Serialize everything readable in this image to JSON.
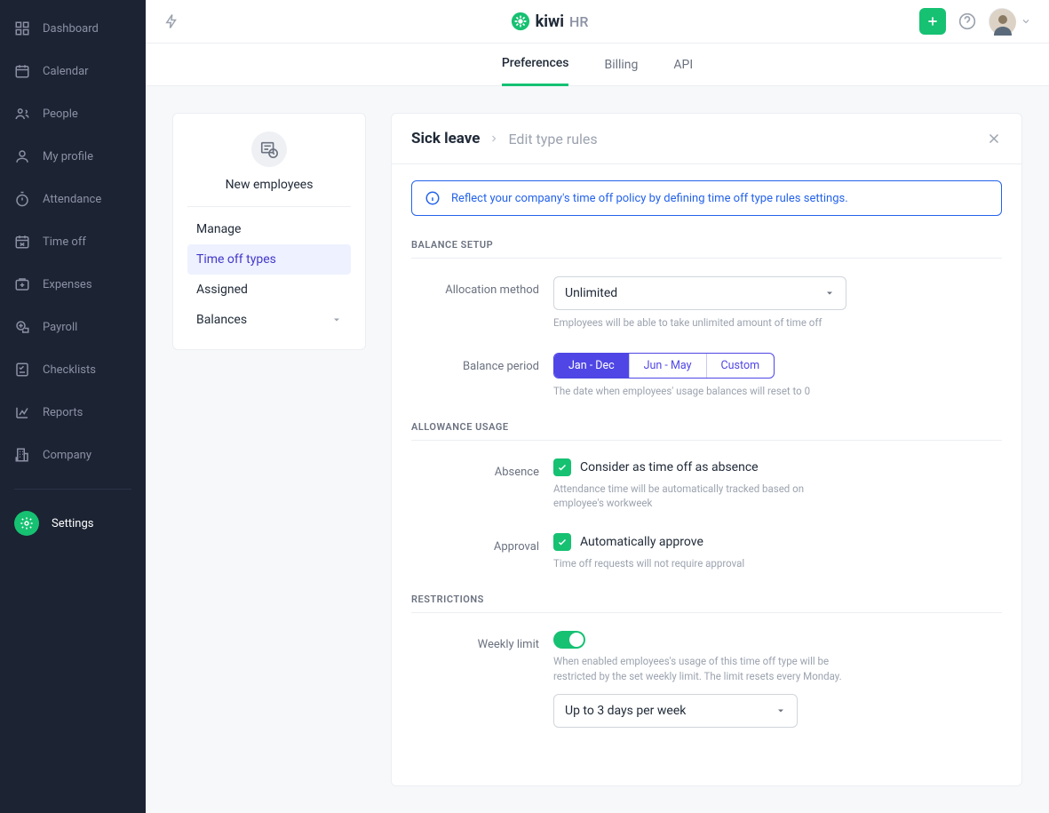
{
  "brand": {
    "name": "kiwi",
    "suffix": "HR"
  },
  "sidebar": {
    "items": [
      {
        "label": "Dashboard"
      },
      {
        "label": "Calendar"
      },
      {
        "label": "People"
      },
      {
        "label": "My profile"
      },
      {
        "label": "Attendance"
      },
      {
        "label": "Time off"
      },
      {
        "label": "Expenses"
      },
      {
        "label": "Payroll"
      },
      {
        "label": "Checklists"
      },
      {
        "label": "Reports"
      },
      {
        "label": "Company"
      }
    ],
    "settings_label": "Settings"
  },
  "tabs": [
    {
      "label": "Preferences",
      "active": true
    },
    {
      "label": "Billing",
      "active": false
    },
    {
      "label": "API",
      "active": false
    }
  ],
  "left_card": {
    "title": "New employees",
    "items": [
      {
        "label": "Manage"
      },
      {
        "label": "Time off types",
        "active": true
      },
      {
        "label": "Assigned"
      },
      {
        "label": "Balances",
        "chevron": true
      }
    ]
  },
  "panel": {
    "breadcrumb": {
      "main": "Sick leave",
      "sub": "Edit type rules"
    },
    "info": "Reflect your company's time off policy by defining time off type rules settings.",
    "sections": {
      "balance_title": "BALANCE SETUP",
      "allowance_title": "ALLOWANCE USAGE",
      "restrictions_title": "RESTRICTIONS"
    },
    "allocation": {
      "label": "Allocation method",
      "value": "Unlimited",
      "help": "Employees will be able to take unlimited amount of time off"
    },
    "balance_period": {
      "label": "Balance period",
      "options": [
        "Jan - Dec",
        "Jun - May",
        "Custom"
      ],
      "help": "The date when employees' usage balances will reset to 0"
    },
    "absence": {
      "label": "Absence",
      "check_label": "Consider as time off as absence",
      "help": "Attendance time will be automatically tracked based on employee's workweek"
    },
    "approval": {
      "label": "Approval",
      "check_label": "Automatically approve",
      "help": "Time off requests will not require approval"
    },
    "weekly_limit": {
      "label": "Weekly limit",
      "help": "When enabled employees's usage of this time off type will be restricted by the set weekly limit. The limit resets every Monday.",
      "value": "Up to 3 days per week"
    }
  }
}
